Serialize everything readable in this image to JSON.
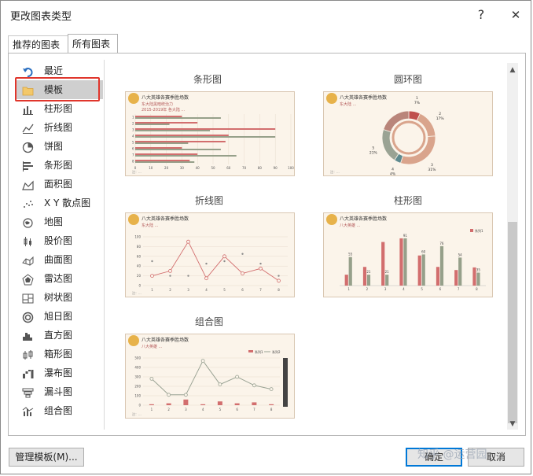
{
  "dialog": {
    "title": "更改图表类型",
    "help_label": "?",
    "close_label": "✕"
  },
  "tabs": [
    {
      "label": "推荐的图表"
    },
    {
      "label": "所有图表"
    }
  ],
  "sidebar": {
    "items": [
      {
        "label": "最近",
        "icon": "undo-icon"
      },
      {
        "label": "模板",
        "icon": "folder-icon"
      },
      {
        "label": "柱形图",
        "icon": "column-chart-icon"
      },
      {
        "label": "折线图",
        "icon": "line-chart-icon"
      },
      {
        "label": "饼图",
        "icon": "pie-chart-icon"
      },
      {
        "label": "条形图",
        "icon": "bar-chart-icon"
      },
      {
        "label": "面积图",
        "icon": "area-chart-icon"
      },
      {
        "label": "X Y 散点图",
        "icon": "scatter-chart-icon"
      },
      {
        "label": "地图",
        "icon": "map-chart-icon"
      },
      {
        "label": "股价图",
        "icon": "stock-chart-icon"
      },
      {
        "label": "曲面图",
        "icon": "surface-chart-icon"
      },
      {
        "label": "雷达图",
        "icon": "radar-chart-icon"
      },
      {
        "label": "树状图",
        "icon": "treemap-chart-icon"
      },
      {
        "label": "旭日图",
        "icon": "sunburst-chart-icon"
      },
      {
        "label": "直方图",
        "icon": "histogram-chart-icon"
      },
      {
        "label": "箱形图",
        "icon": "boxplot-chart-icon"
      },
      {
        "label": "瀑布图",
        "icon": "waterfall-chart-icon"
      },
      {
        "label": "漏斗图",
        "icon": "funnel-chart-icon"
      },
      {
        "label": "组合图",
        "icon": "combo-chart-icon"
      }
    ],
    "selected_index": 1
  },
  "templates": [
    {
      "caption": "条形图",
      "title": "八大英雄各赛季胜场数",
      "subtitle1": "东大陆黑暗统治力",
      "subtitle2": "2015-2019年 各大陆 ...",
      "note": "注：..."
    },
    {
      "caption": "圆环图",
      "title": "八大英雄各赛季胜场数",
      "subtitle1": "东大陆 ...",
      "note": "注：...",
      "labels": [
        {
          "name": "1",
          "pct": "7%"
        },
        {
          "name": "2",
          "pct": "17%"
        },
        {
          "name": "3",
          "pct": "31%"
        },
        {
          "name": "4",
          "pct": "4%"
        },
        {
          "name": "5",
          "pct": "21%"
        }
      ]
    },
    {
      "caption": "折线图",
      "title": "八大英雄各赛季胜场数",
      "subtitle1": "东大陆 ...",
      "note": "注：..."
    },
    {
      "caption": "柱形图",
      "title": "八大英雄各赛季胜场数",
      "subtitle1": "八大英雄 ...",
      "legend": "系列1",
      "note": "注：..."
    },
    {
      "caption": "组合图",
      "title": "八大英雄各赛季胜场数",
      "subtitle1": "八大英雄 ...",
      "legend1": "系列1",
      "legend2": "系列2",
      "note": "注：..."
    }
  ],
  "chart_data": [
    {
      "type": "bar",
      "categories": [
        "1",
        "2",
        "3",
        "4",
        "5",
        "6",
        "7",
        "8"
      ],
      "series": [
        {
          "values": [
            30,
            40,
            90,
            60,
            58,
            30,
            40,
            35
          ]
        },
        {
          "values": [
            55,
            22,
            48,
            90,
            34,
            55,
            65,
            38
          ]
        }
      ],
      "xlim": [
        0,
        100
      ],
      "xticks": [
        "0",
        "10",
        "20",
        "30",
        "40",
        "50",
        "60",
        "70",
        "80",
        "90",
        "100"
      ]
    },
    {
      "type": "pie",
      "values": [
        7,
        17,
        31,
        4,
        21,
        20
      ],
      "labels": [
        "1",
        "2",
        "3",
        "4",
        "5",
        ""
      ]
    },
    {
      "type": "line",
      "categories": [
        "1",
        "2",
        "3",
        "4",
        "5",
        "6",
        "7",
        "8"
      ],
      "series": [
        {
          "values": [
            20,
            30,
            90,
            15,
            60,
            25,
            35,
            10
          ]
        },
        {
          "values": [
            50,
            20,
            20,
            45,
            50,
            65,
            45,
            20
          ]
        }
      ],
      "ylim": [
        0,
        100
      ],
      "yticks": [
        "0",
        "20",
        "40",
        "60",
        "80",
        "100"
      ]
    },
    {
      "type": "bar",
      "categories": [
        "1",
        "2",
        "3",
        "4",
        "5",
        "6",
        "7",
        "8"
      ],
      "series": [
        {
          "values": [
            21,
            36,
            84,
            91,
            58,
            36,
            30,
            35
          ]
        },
        {
          "values": [
            55,
            21,
            21,
            91,
            60,
            76,
            54,
            25
          ]
        }
      ],
      "data_labels": [
        "55",
        "21",
        "21",
        "91",
        "60",
        "76",
        "54",
        "35"
      ]
    },
    {
      "type": "line",
      "categories": [
        "1",
        "2",
        "3",
        "4",
        "5",
        "6",
        "7",
        "8"
      ],
      "series": [
        {
          "name": "系列1",
          "values": [
            10,
            20,
            60,
            10,
            40,
            20,
            30,
            10
          ]
        },
        {
          "name": "系列2",
          "values": [
            280,
            110,
            110,
            470,
            220,
            300,
            210,
            170
          ]
        }
      ],
      "ylim": [
        0,
        500
      ],
      "yticks": [
        "0",
        "100",
        "200",
        "300",
        "400",
        "500"
      ]
    }
  ],
  "footer": {
    "manage_label": "管理模板(M)...",
    "ok_label": "确定",
    "cancel_label": "取消"
  },
  "watermark": "知乎 @运营园"
}
